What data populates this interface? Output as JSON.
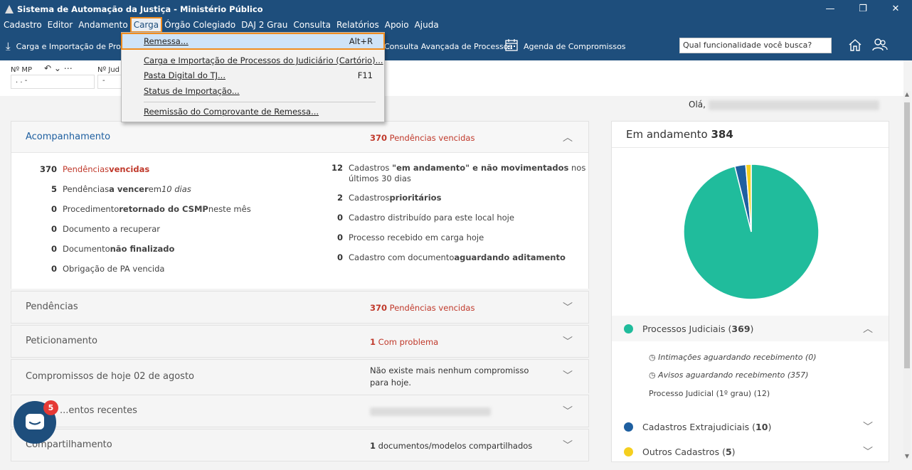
{
  "window": {
    "title": "Sistema de Automação da Justiça - Ministério Público",
    "minimize": "—",
    "restore": "❐",
    "close": "✕"
  },
  "menubar": [
    "Cadastro",
    "Editor",
    "Andamento",
    "Carga",
    "Órgão Colegiado",
    "DAJ 2 Grau",
    "Consulta",
    "Relatórios",
    "Apoio",
    "Ajuda"
  ],
  "toolbar": {
    "carga_label": "Carga e Importação de Pro",
    "consulta_label": "Consulta Avançada de Processos",
    "agenda_label": "Agenda de Compromissos",
    "search_placeholder": "Qual funcionalidade você busca?"
  },
  "filter": {
    "nmp_label": "Nº MP",
    "nmp_value": ".    .        -",
    "njud_label": "Nº Jud",
    "njud_value": "-"
  },
  "dropdown": {
    "items": [
      {
        "label": "Remessa...",
        "shortcut": "Alt+R"
      },
      {
        "label": "Carga e Importação de Processos do Judiciário (Cartório)...",
        "shortcut": ""
      },
      {
        "label": "Pasta Digital do TJ...",
        "shortcut": "F11"
      },
      {
        "label": "Status de Importação...",
        "shortcut": ""
      },
      {
        "label": "Reemissão do Comprovante de Remessa...",
        "shortcut": ""
      }
    ]
  },
  "greeting": "Olá,",
  "acompanhamento": {
    "title": "Acompanhamento",
    "summary_count": "370",
    "summary_text": "Pendências vencidas",
    "left": [
      {
        "num": "370",
        "a": "Pendências ",
        "b": "vencidas",
        "c": ""
      },
      {
        "num": "5",
        "a": "Pendências ",
        "b": "a vencer",
        "c": " em ",
        "d": "10 dias"
      },
      {
        "num": "0",
        "a": "Procedimento ",
        "b": "retornado do CSMP",
        "c": " neste mês"
      },
      {
        "num": "0",
        "a": "Documento a recuperar",
        "b": "",
        "c": ""
      },
      {
        "num": "0",
        "a": "Documento ",
        "b": "não finalizado",
        "c": ""
      },
      {
        "num": "0",
        "a": "Obrigação de PA vencida",
        "b": "",
        "c": ""
      }
    ],
    "right": [
      {
        "num": "12",
        "a": "Cadastros ",
        "b": "\"em andamento\" e não movimentados",
        "c": " nos",
        "line2": "últimos 30 dias"
      },
      {
        "num": "2",
        "a": "Cadastros ",
        "b": "prioritários",
        "c": ""
      },
      {
        "num": "0",
        "a": "Cadastro distribuído para este local hoje",
        "b": "",
        "c": ""
      },
      {
        "num": "0",
        "a": "Processo recebido em carga hoje",
        "b": "",
        "c": ""
      },
      {
        "num": "0",
        "a": "Cadastro com documento ",
        "b": "aguardando aditamento",
        "c": ""
      }
    ]
  },
  "cards": [
    {
      "title": "Pendências",
      "count": "370",
      "text": "Pendências vencidas"
    },
    {
      "title": "Peticionamento",
      "count": "1",
      "text": "Com problema"
    },
    {
      "title": "Compromissos de hoje 02 de agosto",
      "count": "",
      "text": "Não existe mais nenhum compromisso para hoje."
    },
    {
      "title": "...entos recentes",
      "count": "",
      "text": ""
    },
    {
      "title": "Compartilhamento",
      "count": "1",
      "text": "documentos/modelos compartilhados"
    }
  ],
  "chat_badge": "5",
  "right_panel": {
    "title": "Em andamento",
    "total": "384",
    "colors": {
      "judiciais": "#20bc9c",
      "extrajudiciais": "#1e5fa0",
      "outros": "#f5cf1f"
    },
    "legend": [
      {
        "name": "Processos Judiciais",
        "count": "369"
      },
      {
        "name": "Cadastros Extrajudiciais",
        "count": "10"
      },
      {
        "name": "Outros Cadastros",
        "count": "5"
      }
    ],
    "sub": [
      "Intimações aguardando recebimento (0)",
      "Avisos aguardando recebimento (357)",
      "Processo Judicial (1º grau) (12)"
    ]
  },
  "chart_data": {
    "type": "pie",
    "categories": [
      "Processos Judiciais",
      "Cadastros Extrajudiciais",
      "Outros Cadastros"
    ],
    "values": [
      369,
      10,
      5
    ],
    "title": "Em andamento 384"
  }
}
